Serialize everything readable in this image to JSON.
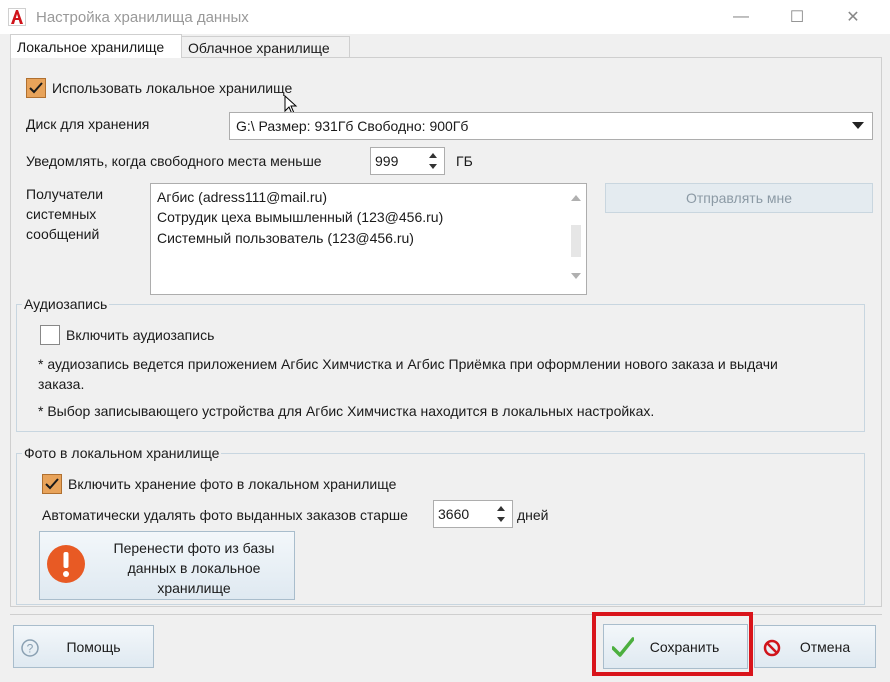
{
  "window": {
    "title": "Настройка хранилища данных",
    "minimize_glyph": "—",
    "maximize_glyph": "☐",
    "close_glyph": "✕"
  },
  "tabs": [
    {
      "label": "Локальное хранилище",
      "active": true
    },
    {
      "label": "Облачное хранилище",
      "active": false
    }
  ],
  "local": {
    "use_local_label": "Использовать локальное хранилище",
    "use_local_checked": true,
    "disk_label": "Диск для хранения",
    "disk_value": "G:\\ Размер: 931Гб Свободно: 900Гб",
    "notify_label": "Уведомлять, когда свободного места меньше",
    "notify_value": "999",
    "notify_unit": "ГБ",
    "recipients_label_1": "Получатели",
    "recipients_label_2": "системных",
    "recipients_label_3": "сообщений",
    "recipients": [
      "Агбис (adress111@mail.ru)",
      "Сотрудик цеха вымышленный (123@456.ru)",
      "Системный пользователь (123@456.ru)"
    ],
    "send_me_label": "Отправлять мне"
  },
  "audio": {
    "group_title": "Аудиозапись",
    "enable_label": "Включить аудиозапись",
    "enable_checked": false,
    "note_1a": "* аудиозапись ведется приложением Агбис Химчистка и Агбис Приёмка при оформлении нового заказа и выдачи",
    "note_1b": "заказа.",
    "note_2": "* Выбор записывающего устройства для Агбис Химчистка находится в локальных настройках."
  },
  "photo": {
    "group_title": "Фото в локальном хранилище",
    "enable_label": "Включить хранение фото в локальном хранилище",
    "enable_checked": true,
    "auto_delete_label": "Автоматически удалять фото выданных заказов старше",
    "auto_delete_value": "3660",
    "auto_delete_unit": "дней",
    "transfer_line_1": "Перенести фото из базы",
    "transfer_line_2": "данных в локальное",
    "transfer_line_3": "хранилище"
  },
  "footer": {
    "help_label": "Помощь",
    "save_label": "Сохранить",
    "cancel_label": "Отмена"
  },
  "colors": {
    "checkbox_checked": "#e8a35a",
    "highlight_box": "#d9141b",
    "save_icon": "#4caf3f",
    "cancel_icon": "#d0141b",
    "warning_icon": "#e85a24"
  }
}
